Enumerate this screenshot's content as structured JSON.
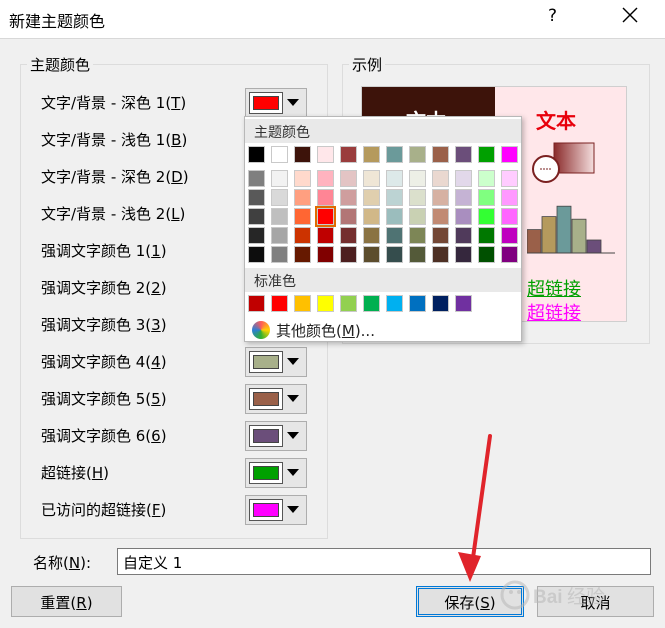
{
  "window": {
    "title": "新建主题颜色",
    "help_glyph": "?"
  },
  "theme_group": {
    "legend": "主题颜色",
    "rows": [
      {
        "text": "文字/背景 - 深色 1(",
        "key": "T",
        "color": "#ff0000"
      },
      {
        "text": "文字/背景 - 浅色 1(",
        "key": "B",
        "color": "#ffffff"
      },
      {
        "text": "文字/背景 - 深色 2(",
        "key": "D",
        "color": "#3d130a"
      },
      {
        "text": "文字/背景 - 浅色 2(",
        "key": "L",
        "color": "#ffe7ea"
      },
      {
        "text": "强调文字颜色 1(",
        "key": "1",
        "color": "#9a3d3d"
      },
      {
        "text": "强调文字颜色 2(",
        "key": "2",
        "color": "#b59a5d"
      },
      {
        "text": "强调文字颜色 3(",
        "key": "3",
        "color": "#6b9a9a"
      },
      {
        "text": "强调文字颜色 4(",
        "key": "4",
        "color": "#a8b08a"
      },
      {
        "text": "强调文字颜色 5(",
        "key": "5",
        "color": "#9a6049"
      },
      {
        "text": "强调文字颜色 6(",
        "key": "6",
        "color": "#6b4e7a"
      },
      {
        "text": "超链接(",
        "key": "H",
        "color": "#00a000"
      },
      {
        "text": "已访问的超链接(",
        "key": "F",
        "color": "#ff00ff"
      }
    ]
  },
  "sample_group": {
    "legend": "示例",
    "text_dark": "文本",
    "text_light": "文本",
    "link": "超链接",
    "visited_link": "超链接",
    "bar_colors": [
      "#9a6049",
      "#b59a5d",
      "#6b9a9a",
      "#a8b08a",
      "#6b4e7a"
    ],
    "bar_values": [
      0.45,
      0.7,
      0.9,
      0.65,
      0.25
    ]
  },
  "color_popup": {
    "theme_header": "主题颜色",
    "theme_top": [
      "#000000",
      "#ffffff",
      "#3d130a",
      "#ffe7ea",
      "#9a3d3d",
      "#b59a5d",
      "#6b9a9a",
      "#a8b08a",
      "#9a6049",
      "#6b4e7a",
      "#00a000",
      "#ff00ff"
    ],
    "theme_shades": [
      [
        "#7f7f7f",
        "#f2f2f2",
        "#ffd9cc",
        "#ffb3bf",
        "#e3c4c4",
        "#efe6d6",
        "#dde9e9",
        "#edefe6",
        "#ead8d0",
        "#e2d8ea",
        "#ccffcc",
        "#ffccff"
      ],
      [
        "#595959",
        "#d9d9d9",
        "#ff9f80",
        "#ff8595",
        "#cf9e9e",
        "#e0cfae",
        "#bcd3d3",
        "#dbe0cc",
        "#d6b1a2",
        "#c5b3d4",
        "#80ff80",
        "#ff99ff"
      ],
      [
        "#404040",
        "#bfbfbf",
        "#ff6633",
        "#ff0000",
        "#b27676",
        "#d1b888",
        "#9bbdbd",
        "#c9d1b3",
        "#c18a73",
        "#a98ebf",
        "#33ff33",
        "#ff66ff"
      ],
      [
        "#262626",
        "#a6a6a6",
        "#cc3300",
        "#bf0000",
        "#742e2e",
        "#8a7343",
        "#4f7373",
        "#7d8656",
        "#734735",
        "#503a5b",
        "#007800",
        "#bf00bf"
      ],
      [
        "#0d0d0d",
        "#808080",
        "#661900",
        "#800000",
        "#4d1f1f",
        "#5c4d2d",
        "#354d4d",
        "#545a39",
        "#4d3024",
        "#35273d",
        "#005000",
        "#800080"
      ]
    ],
    "selected": [
      2,
      3
    ],
    "standard_header": "标准色",
    "standard": [
      "#c00000",
      "#ff0000",
      "#ffc000",
      "#ffff00",
      "#92d050",
      "#00b050",
      "#00b0f0",
      "#0070c0",
      "#002060",
      "#7030a0"
    ],
    "more_label": "其他颜色(",
    "more_key": "M",
    "more_suffix": ")..."
  },
  "name_field": {
    "label": "名称(",
    "key": "N",
    "label_suffix": "):",
    "value": "自定义 1"
  },
  "buttons": {
    "reset": {
      "text": "重置(",
      "key": "R"
    },
    "save": {
      "text": "保存(",
      "key": "S"
    },
    "cancel": {
      "text": "取消"
    }
  },
  "watermark": {
    "text": "Baidu经验"
  },
  "annotation_color": "#e0242b"
}
